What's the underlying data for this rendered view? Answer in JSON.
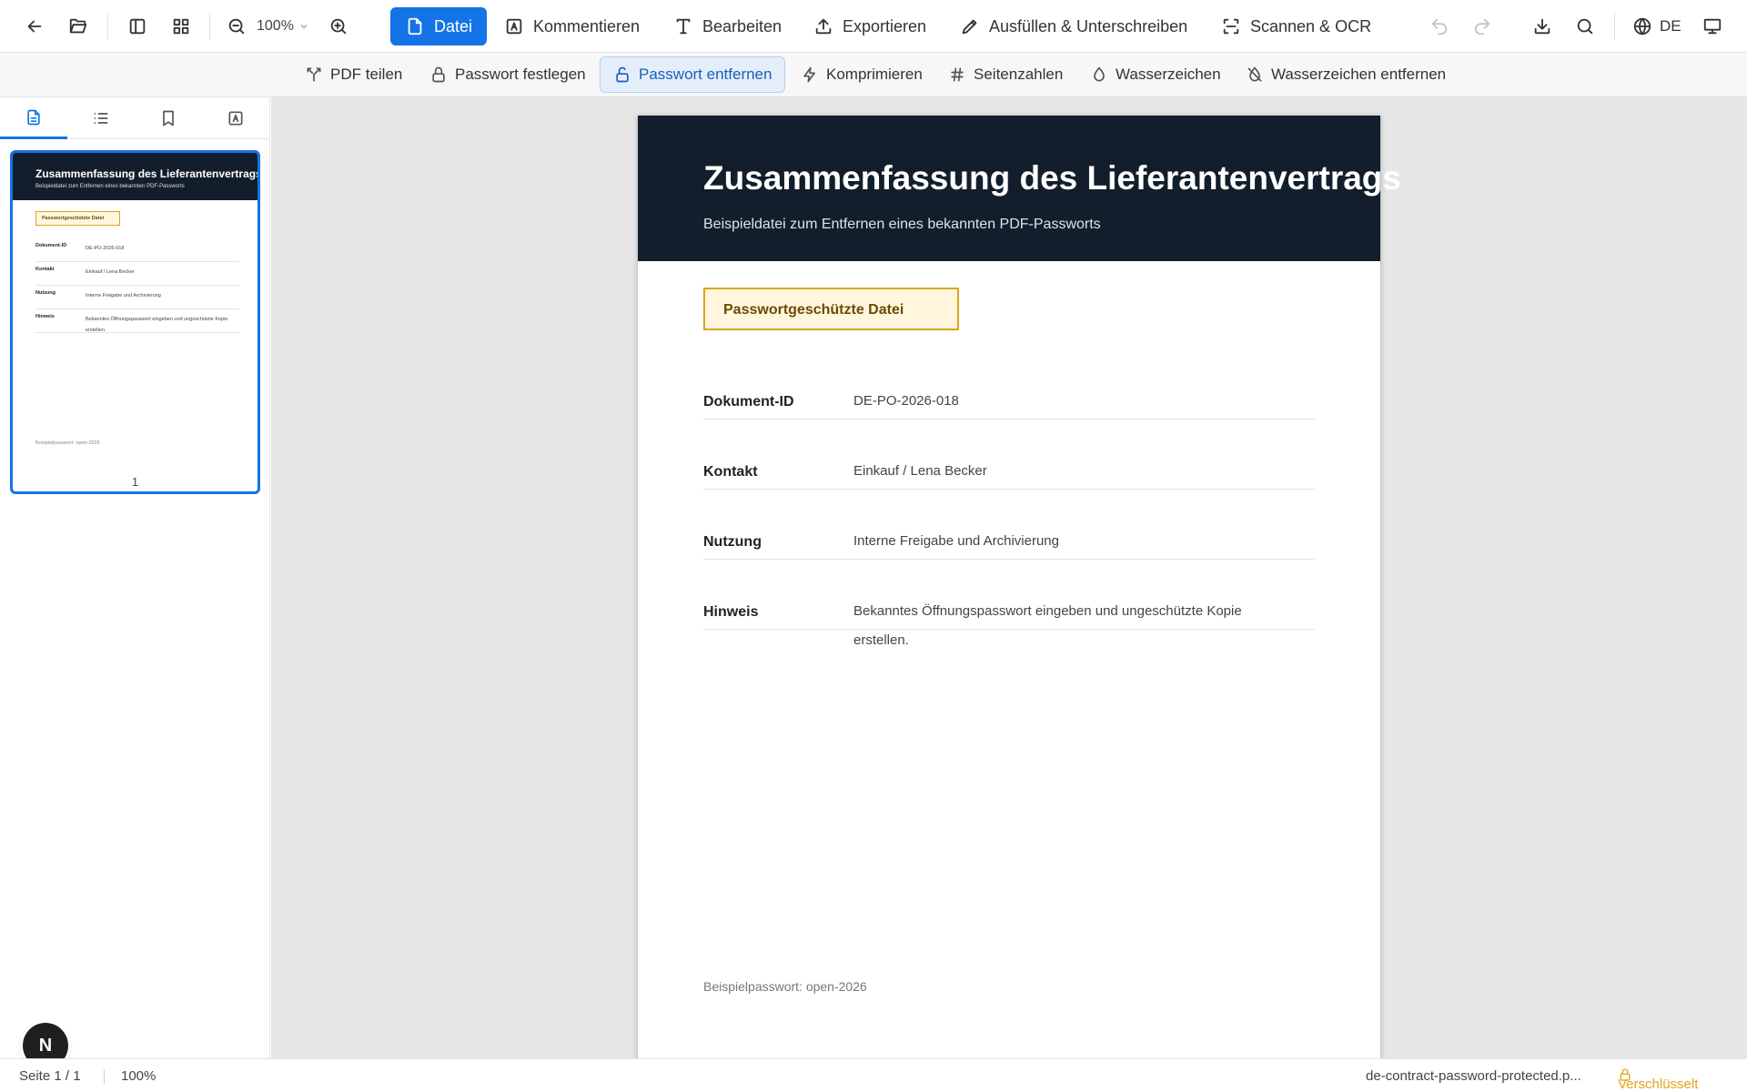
{
  "toolbar": {
    "zoom": "100%",
    "tabs": [
      {
        "label": "Datei"
      },
      {
        "label": "Kommentieren"
      },
      {
        "label": "Bearbeiten"
      },
      {
        "label": "Exportieren"
      },
      {
        "label": "Ausfüllen & Unterschreiben"
      },
      {
        "label": "Scannen & OCR"
      }
    ],
    "language": "DE"
  },
  "subtoolbar": {
    "items": [
      {
        "label": "PDF teilen"
      },
      {
        "label": "Passwort festlegen"
      },
      {
        "label": "Passwort entfernen"
      },
      {
        "label": "Komprimieren"
      },
      {
        "label": "Seitenzahlen"
      },
      {
        "label": "Wasserzeichen"
      },
      {
        "label": "Wasserzeichen entfernen"
      }
    ]
  },
  "sidebar": {
    "thumbnail_page_number": "1"
  },
  "document": {
    "title": "Zusammenfassung des Lieferantenvertrags",
    "subtitle": "Beispieldatei zum Entfernen eines bekannten PDF-Passworts",
    "badge": "Passwortgeschützte Datei",
    "rows": [
      {
        "key": "Dokument-ID",
        "value": "DE-PO-2026-018"
      },
      {
        "key": "Kontakt",
        "value": "Einkauf / Lena Becker"
      },
      {
        "key": "Nutzung",
        "value": "Interne Freigabe und Archivierung"
      },
      {
        "key": "Hinweis",
        "value": "Bekanntes Öffnungspasswort eingeben und ungeschützte Kopie erstellen."
      }
    ],
    "footer": "Beispielpasswort: open-2026"
  },
  "fab": {
    "label": "N"
  },
  "status": {
    "page": "Seite 1 / 1",
    "zoom": "100%",
    "filename": "de-contract-password-protected.p...",
    "security": "Verschlüsselt"
  },
  "colors": {
    "accent": "#1473e6",
    "header_dark": "#131e2d",
    "badge_border": "#d9a520",
    "badge_bg": "#fff6dd",
    "locked": "#e6a21a"
  }
}
